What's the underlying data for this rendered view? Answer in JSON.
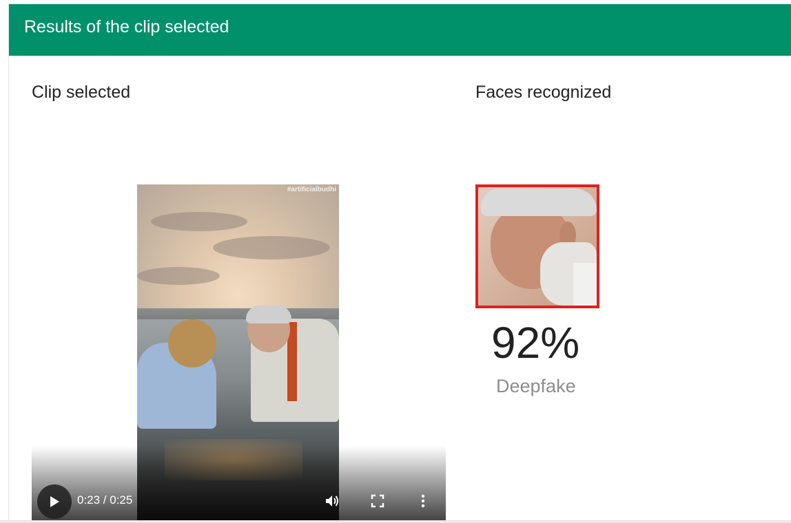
{
  "header": {
    "title": "Results of the clip selected",
    "color": "#00916a"
  },
  "clip_section": {
    "title": "Clip selected",
    "player": {
      "watermark": "#artificialbudhi",
      "time": "0:23 / 0:25",
      "progress": 0.92,
      "icons": [
        "play-icon",
        "volume-icon",
        "fullscreen-icon",
        "more-icon"
      ]
    }
  },
  "faces_section": {
    "title": "Faces recognized",
    "faces": [
      {
        "score": "92%",
        "verdict": "Deepfake",
        "box_color": "#e0201d"
      }
    ]
  }
}
